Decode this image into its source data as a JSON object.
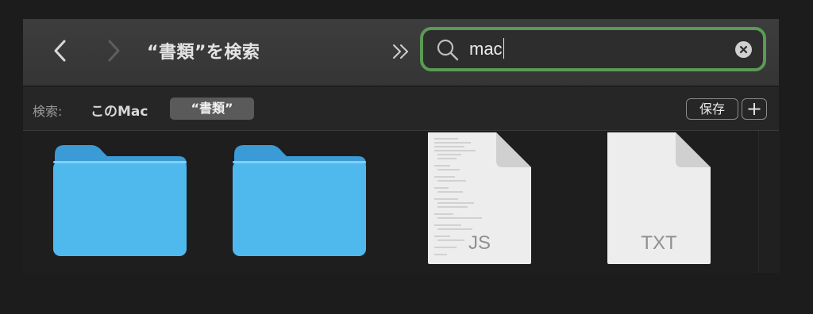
{
  "toolbar": {
    "back_icon": "chevron-left-icon",
    "forward_icon": "chevron-right-icon",
    "title": "“書類”を検索",
    "more_icon": "double-chevron-right-icon"
  },
  "search": {
    "value": "mac",
    "focus_color": "#5a9a55",
    "search_icon": "magnifier-icon",
    "clear_icon": "clear-x-icon"
  },
  "scope": {
    "label": "検索:",
    "this_mac": "このMac",
    "selected": "“書類”",
    "save_label": "保存",
    "add_icon": "plus-icon"
  },
  "items": [
    {
      "kind": "folder",
      "icon": "folder-icon",
      "color": "#4fb9ee"
    },
    {
      "kind": "folder",
      "icon": "folder-icon",
      "color": "#4fb9ee"
    },
    {
      "kind": "file",
      "icon": "js-file-icon",
      "ext_label": "JS"
    },
    {
      "kind": "file",
      "icon": "txt-file-icon",
      "ext_label": "TXT"
    }
  ]
}
